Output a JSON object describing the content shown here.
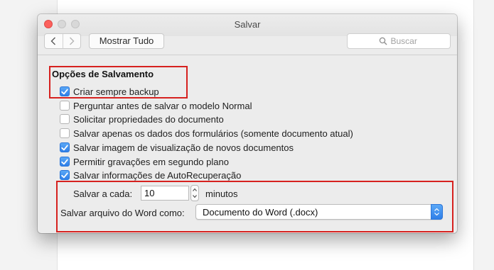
{
  "window": {
    "title": "Salvar",
    "show_all_label": "Mostrar Tudo",
    "search_placeholder": "Buscar"
  },
  "section": {
    "title": "Opções de Salvamento"
  },
  "options": [
    {
      "label": "Criar sempre backup",
      "checked": true
    },
    {
      "label": "Perguntar antes de salvar o modelo Normal",
      "checked": false
    },
    {
      "label": "Solicitar propriedades do documento",
      "checked": false
    },
    {
      "label": "Salvar apenas os dados dos formulários (somente documento atual)",
      "checked": false
    },
    {
      "label": "Salvar imagem de visualização de novos documentos",
      "checked": true
    },
    {
      "label": "Permitir gravações em segundo plano",
      "checked": true
    },
    {
      "label": "Salvar informações de AutoRecuperação",
      "checked": true
    }
  ],
  "autosave": {
    "label": "Salvar a cada:",
    "value": "10",
    "unit": "minutos"
  },
  "format": {
    "label": "Salvar arquivo do Word como:",
    "selected": "Documento do Word (.docx)"
  },
  "colors": {
    "accent": "#2f7fe8",
    "highlight_box": "#d6211f",
    "close_button": "#fc605c"
  }
}
